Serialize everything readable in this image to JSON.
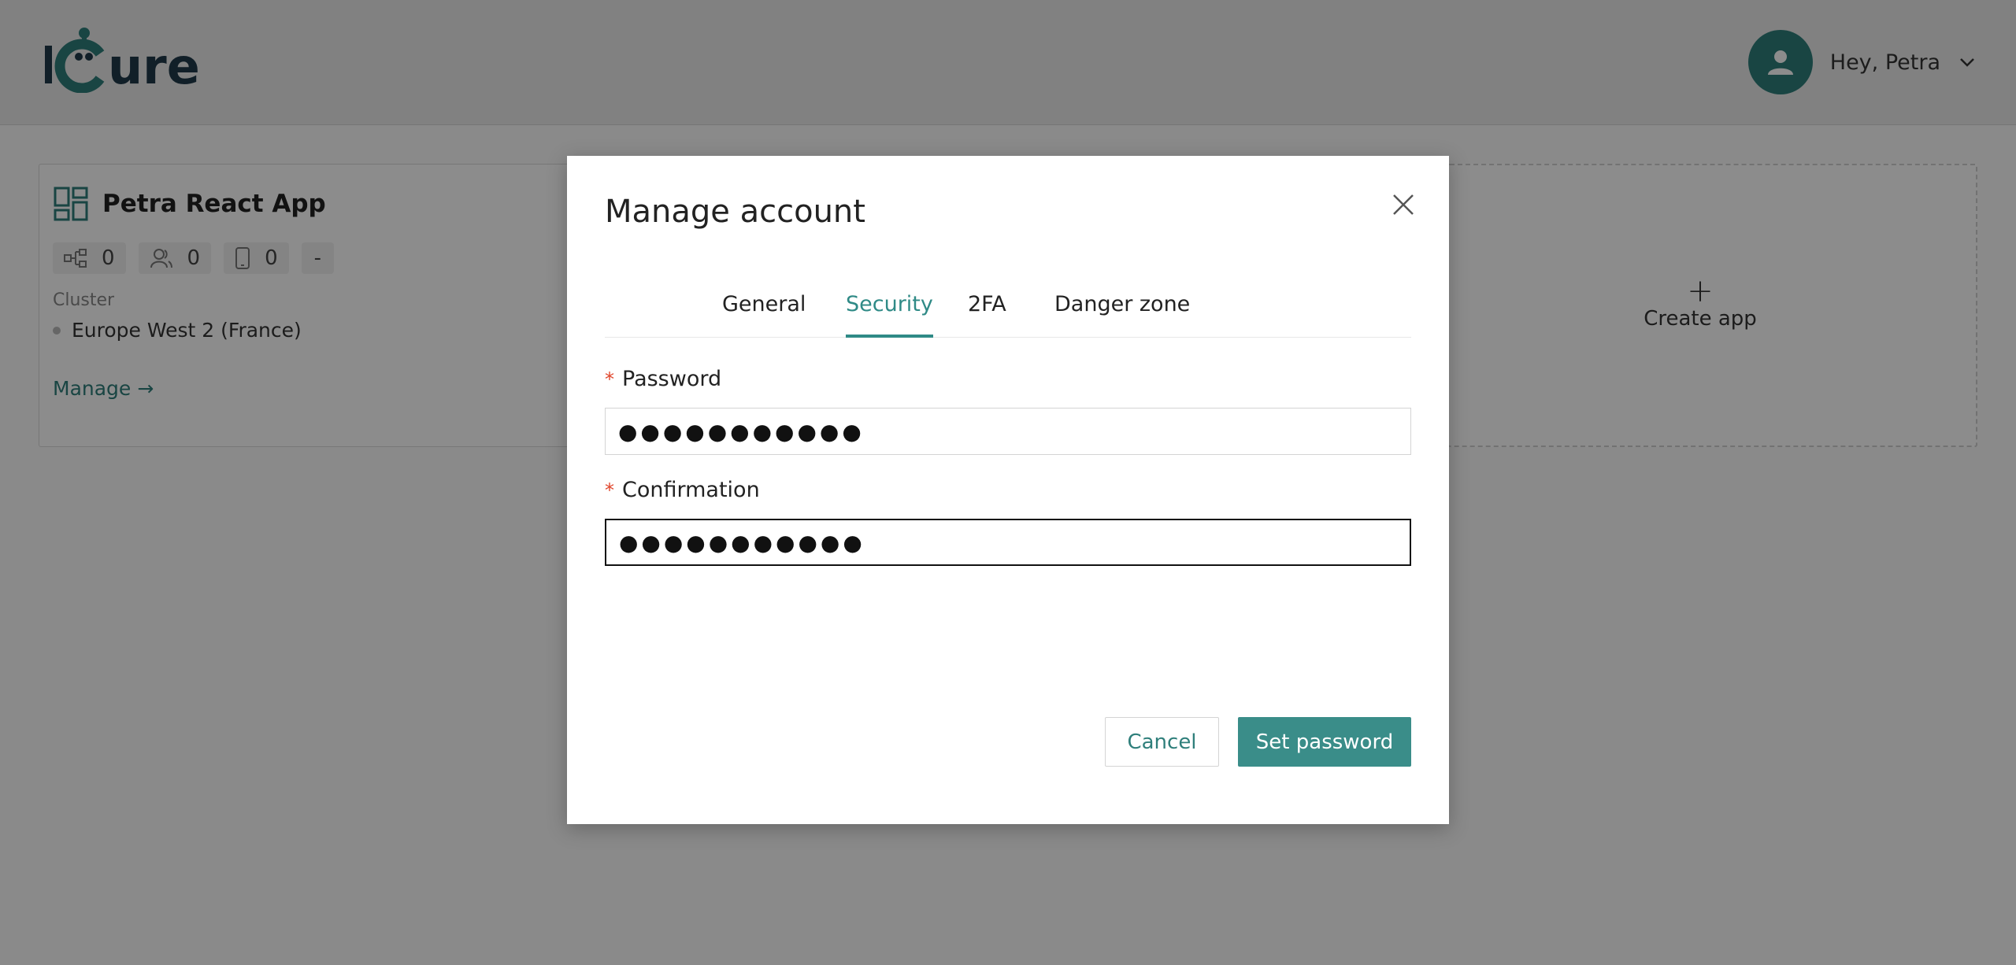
{
  "header": {
    "logo_text": "iCure",
    "greeting": "Hey, Petra",
    "avatar_icon": "user-icon",
    "dropdown_icon": "chevron-down-icon"
  },
  "app_card": {
    "title": "Petra React App",
    "icon": "dashboard-grid-icon",
    "stats": [
      {
        "icon": "hierarchy-icon",
        "value": "0"
      },
      {
        "icon": "users-icon",
        "value": "0"
      },
      {
        "icon": "device-icon",
        "value": "0"
      },
      {
        "value": "-"
      }
    ],
    "cluster_label": "Cluster",
    "cluster_value": "Europe West 2 (France)",
    "manage_label": "Manage",
    "manage_arrow": "→"
  },
  "create_card": {
    "plus": "+",
    "label": "Create app"
  },
  "modal": {
    "title": "Manage account",
    "close_icon": "close-icon",
    "tabs": [
      {
        "label": "General",
        "active": false
      },
      {
        "label": "Security",
        "active": true
      },
      {
        "label": "2FA",
        "active": false
      },
      {
        "label": "Danger zone",
        "active": false
      }
    ],
    "password": {
      "required_mark": "*",
      "label": "Password",
      "value": "●●●●●●●●●●●"
    },
    "confirmation": {
      "required_mark": "*",
      "label": "Confirmation",
      "value": "●●●●●●●●●●●"
    },
    "cancel_label": "Cancel",
    "submit_label": "Set password"
  },
  "colors": {
    "accent": "#2f8a86",
    "primary_button": "#3a8d89",
    "required": "#e0452b"
  }
}
